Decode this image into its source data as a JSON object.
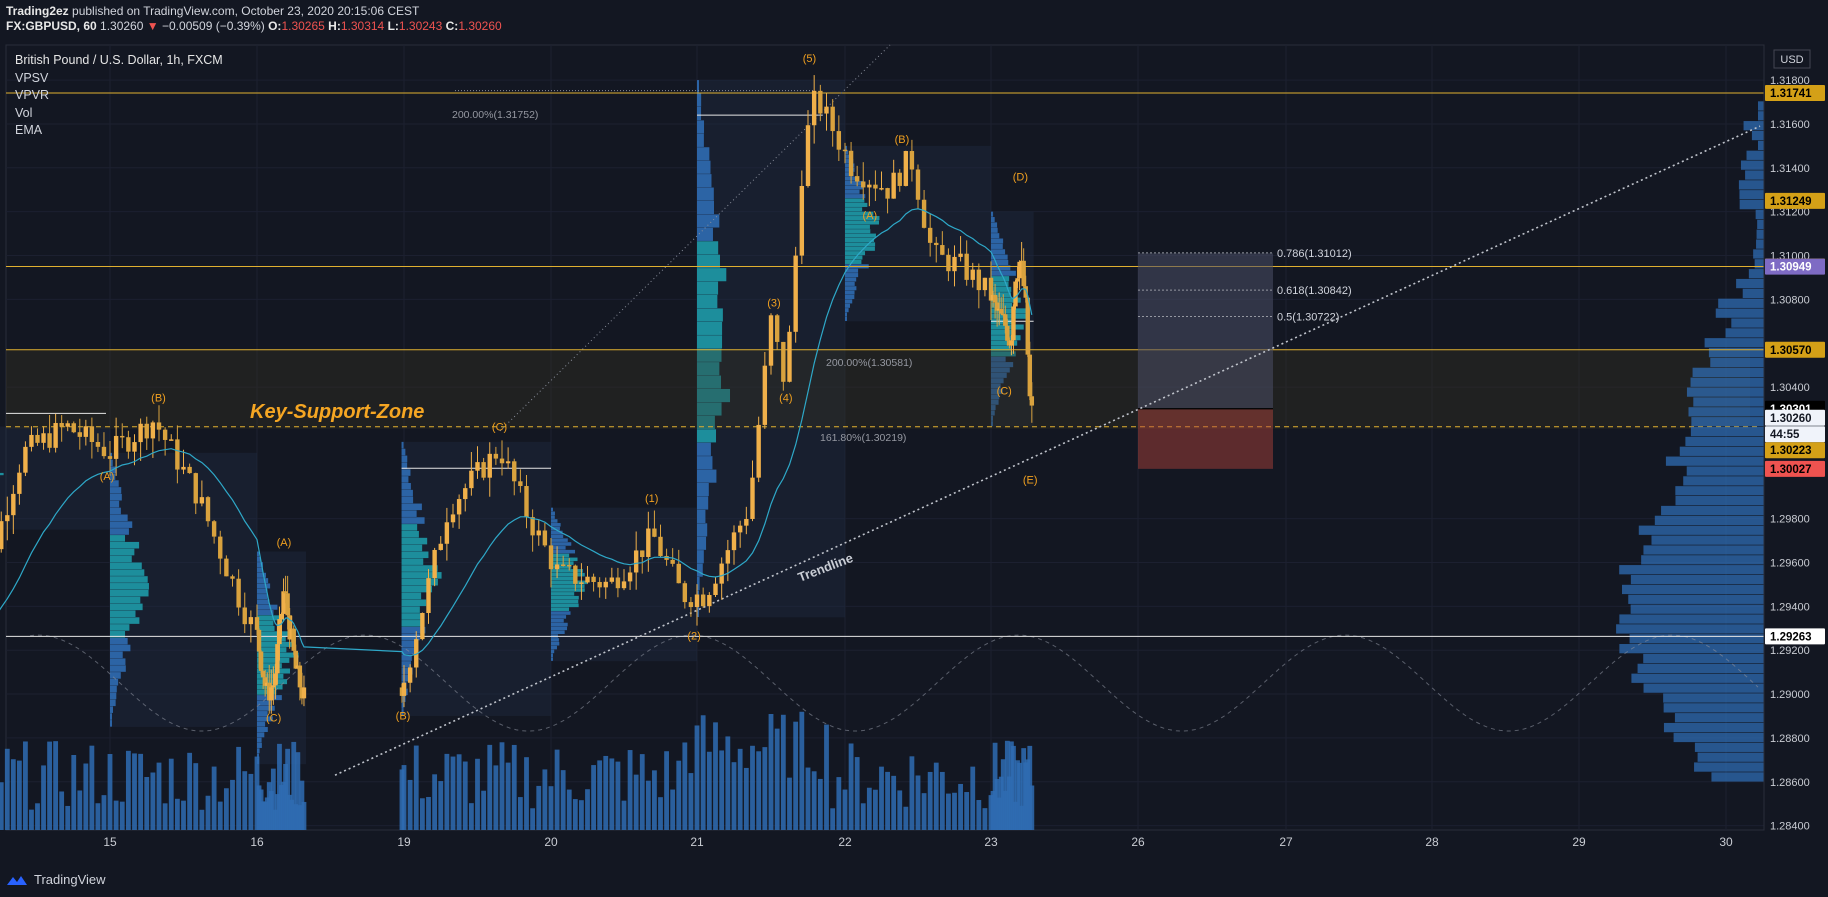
{
  "header": {
    "publisher": "Trading2ez",
    "published_text": "published on TradingView.com, October 23, 2020 20:15:06 CEST",
    "symbol": "FX:GBPUSD, 60",
    "last": "1.30260",
    "change": "−0.00509 (−0.39%)",
    "o_label": "O:",
    "o": "1.30265",
    "h_label": "H:",
    "h": "1.30314",
    "l_label": "L:",
    "l": "1.30243",
    "c_label": "C:",
    "c": "1.30260"
  },
  "legend": {
    "title": "British Pound / U.S. Dollar, 1h, FXCM",
    "indicators": [
      "VPSV",
      "VPVR",
      "Vol",
      "EMA"
    ]
  },
  "currency_button": "USD",
  "footer": {
    "brand": "TradingView"
  },
  "colors": {
    "background": "#131722",
    "candle_up": "#f0b04a",
    "candle_down": "#d9a23e",
    "level_line": "#e0b030",
    "white_line": "#e6e6e6",
    "ema": "#2ea8c8",
    "volume": "#2f6cb3",
    "profile": "#2f6cb3",
    "profile_value_area": "#1e9aa8",
    "wave_label": "#f0a020",
    "support_zone_text": "#f5a623"
  },
  "chart_data": {
    "type": "candlestick",
    "title": "British Pound / U.S. Dollar, 1h, FXCM",
    "x_ticks": [
      "15",
      "16",
      "19",
      "20",
      "21",
      "22",
      "23",
      "26",
      "27",
      "28",
      "29",
      "30"
    ],
    "y_ticks": [
      "1.31800",
      "1.31600",
      "1.31400",
      "1.31200",
      "1.31000",
      "1.30800",
      "1.30400",
      "1.29800",
      "1.29600",
      "1.29400",
      "1.29200",
      "1.29000",
      "1.28800",
      "1.28600",
      "1.28400"
    ],
    "ylim": [
      1.2838,
      1.3196
    ],
    "price_badges": [
      {
        "text": "1.31741",
        "value": 1.31741,
        "bg": "#d4a017",
        "fg": "#000000"
      },
      {
        "text": "1.31249",
        "value": 1.31249,
        "bg": "#d4a017",
        "fg": "#000000"
      },
      {
        "text": "1.30950",
        "value": 1.3095,
        "bg": "#d4a017",
        "fg": "#000000"
      },
      {
        "text": "1.30949",
        "value": 1.30949,
        "bg": "#7e6bc4",
        "fg": "#ffffff"
      },
      {
        "text": "1.30570",
        "value": 1.3057,
        "bg": "#d4a017",
        "fg": "#000000"
      },
      {
        "text": "1.30301",
        "value": 1.30301,
        "bg": "#000000",
        "fg": "#ffffff"
      },
      {
        "text": "1.30260",
        "value": 1.3026,
        "bg": "#f0f3fa",
        "fg": "#131722"
      },
      {
        "text": "44:55",
        "value": 1.30185,
        "bg": "#f0f3fa",
        "fg": "#131722"
      },
      {
        "text": "1.30223",
        "value": 1.30112,
        "bg": "#d4a017",
        "fg": "#000000"
      },
      {
        "text": "1.30027",
        "value": 1.30027,
        "bg": "#ef5350",
        "fg": "#000000"
      },
      {
        "text": "1.29263",
        "value": 1.29263,
        "bg": "#ffffff",
        "fg": "#000000"
      }
    ],
    "horizontal_levels": [
      {
        "value": 1.31741,
        "color": "#e0b030"
      },
      {
        "value": 1.3095,
        "color": "#e0b030"
      },
      {
        "value": 1.3057,
        "color": "#e0b030"
      },
      {
        "value": 1.29263,
        "color": "#e6e6e6"
      }
    ],
    "annotations": {
      "key_support_zone": "Key-Support-Zone",
      "trendline_label": "Trendline",
      "fib_ext_top": "200.00%(1.31752)",
      "fib_ext_mid": "200.00%(1.30581)",
      "fib_ext_low": "161.80%(1.30219)",
      "fib_786": "0.786(1.31012)",
      "fib_618": "0.618(1.30842)",
      "fib_5": "0.5(1.30722)"
    },
    "wave_labels": [
      {
        "text": "(B)",
        "day": 15.33,
        "price": 1.30334
      },
      {
        "text": "(A)",
        "day": 14.98,
        "price": 1.29977
      },
      {
        "text": "(A)",
        "day": 16.55,
        "price": 1.29675
      },
      {
        "text": "(C)",
        "day": 16.34,
        "price": 1.28874
      },
      {
        "text": "(C)",
        "day": 19.65,
        "price": 1.30201
      },
      {
        "text": "(B)",
        "day": 18.98,
        "price": 1.28885
      },
      {
        "text": "(1)",
        "day": 20.69,
        "price": 1.29875
      },
      {
        "text": "(2)",
        "day": 20.98,
        "price": 1.29248
      },
      {
        "text": "(3)",
        "day": 21.52,
        "price": 1.30767
      },
      {
        "text": "(4)",
        "day": 21.6,
        "price": 1.30334
      },
      {
        "text": "(5)",
        "day": 21.76,
        "price": 1.31882
      },
      {
        "text": "(B)",
        "day": 22.39,
        "price": 1.31514
      },
      {
        "text": "(A)",
        "day": 22.17,
        "price": 1.31167
      },
      {
        "text": "(C)",
        "day": 23.27,
        "price": 1.30367
      },
      {
        "text": "(D)",
        "day": 23.6,
        "price": 1.31341
      },
      {
        "text": "(E)",
        "day": 23.8,
        "price": 1.29961
      }
    ]
  }
}
